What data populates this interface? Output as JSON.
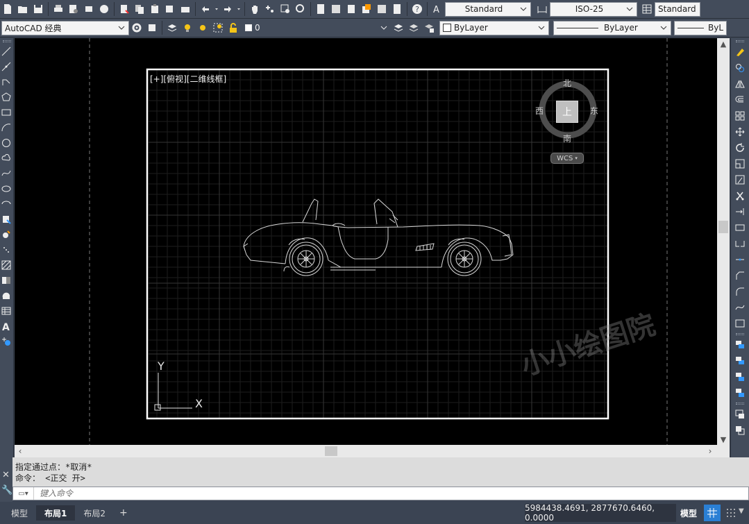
{
  "toolbar1": {
    "text_style": "Standard",
    "dim_style": "ISO-25",
    "table_style": "Standard"
  },
  "toolbar2": {
    "workspace": "AutoCAD 经典",
    "layer": "0",
    "color": "ByLayer",
    "linetype": "ByLayer",
    "lineweight": "ByLa"
  },
  "viewport": {
    "label": "[+][俯视][二维线框]",
    "watermark": "小小绘图院"
  },
  "viewcube": {
    "north": "北",
    "south": "南",
    "east": "东",
    "west": "西",
    "top": "上",
    "wcs": "WCS"
  },
  "ucs": {
    "x": "X",
    "y": "Y"
  },
  "command": {
    "history": [
      "指定通过点：*取消*",
      "命令： <正交 开>"
    ],
    "placeholder": "键入命令"
  },
  "status": {
    "tabs": [
      "模型",
      "布局1",
      "布局2"
    ],
    "active_tab": "布局1",
    "add_tab": "+",
    "coordinates": "5984438.4691, 2877670.6460, 0.0000",
    "model_label": "模型"
  },
  "colors": {
    "accent": "#2a7fd4",
    "canvas": "#000000",
    "panel": "#434c5b"
  }
}
